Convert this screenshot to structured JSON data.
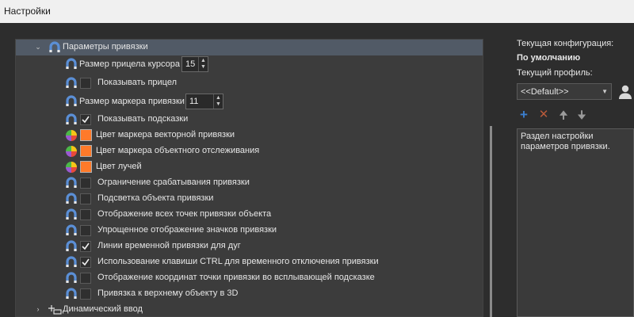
{
  "window": {
    "title": "Настройки"
  },
  "tree": {
    "group_snap": "Параметры привязки",
    "cursor_size_label": "Размер прицела курсора",
    "cursor_size_value": "15",
    "show_crosshair": "Показывать прицел",
    "marker_size_label": "Размер маркера привязки",
    "marker_size_value": "11",
    "show_hints": "Показывать подсказки",
    "vector_marker_color": "Цвет маркера векторной привязки",
    "tracking_marker_color": "Цвет маркера объектного отслеживания",
    "ray_color": "Цвет лучей",
    "limit_triggering": "Ограничение срабатывания привязки",
    "highlight_object": "Подсветка объекта привязки",
    "show_all_points": "Отображение всех точек привязки объекта",
    "simplified_icons": "Упрощенное отображение значков привязки",
    "temp_arc_lines": "Линии временной привязки для дуг",
    "ctrl_disable": "Использование клавиши CTRL для временного отключения привязки",
    "coords_tooltip": "Отображение координат точки привязки во всплывающей подсказке",
    "snap_top_3d": "Привязка к верхнему объекту в 3D",
    "group_dynamic": "Динамический ввод"
  },
  "side": {
    "current_config_label": "Текущая конфигурация:",
    "current_config_value": "По умолчанию",
    "current_profile_label": "Текущий профиль:",
    "profile_value": "<<Default>>",
    "description": "Раздел настройки параметров привязки."
  },
  "colors": {
    "swatch": "#ff7a2a",
    "magnet": "#5b8fd6",
    "selected_row": "#515a66"
  }
}
